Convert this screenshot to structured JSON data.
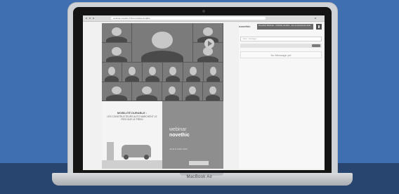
{
  "device": {
    "brand_label": "MacBook Air"
  },
  "browser": {
    "url": "webinar.novethic.fr/live/mobilite-durable"
  },
  "video": {
    "tiles": 18
  },
  "poster_left": {
    "title": "MOBILITÉ DURABLE :",
    "subtitle": "LES CONSTRUCTEURS AUTO MARCHENT LE PIED SUR LE FREIN"
  },
  "poster_right": {
    "word1": "webinar",
    "word2": "novethic",
    "date": "Jeudi 9 Juillet 2020"
  },
  "chat": {
    "logo_text": "novethic",
    "info_text": "Novethic Webinar · Mobilité durable · les constructeurs auto",
    "message_placeholder": "Votre message...",
    "empty_state": "No Message yet"
  },
  "colors": {
    "background": "#3f6fb0",
    "floor": "#27456e"
  }
}
